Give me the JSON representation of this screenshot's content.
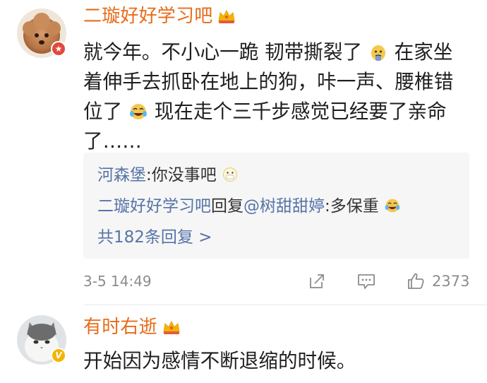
{
  "comments": [
    {
      "username": "二璇好好学习吧",
      "badge_icon": "crown-vip-icon",
      "avatar_icon": "poodle-dog-avatar",
      "avatar_badge_icon": "red-star-badge-icon",
      "content": {
        "line1_a": "就今年。不小心一跪 韧带撕裂了",
        "line1_emoji": "facepalm-emoji-icon",
        "line1_b": "在家坐",
        "line2": "着伸手去抓卧在地上的狗，咔一声、腰椎错",
        "line3_a": "位了",
        "line3_emoji": "laughing-crying-emoji-icon",
        "line3_b": "现在走个三千步感觉已经要了亲命",
        "line4": "了……"
      },
      "replies": [
        {
          "name": "河森堡",
          "separator": ":",
          "text": "你没事吧",
          "emoji": "mask-face-emoji-icon"
        },
        {
          "name": "二璇好好学习吧",
          "middle": "回复",
          "mention": "@树甜甜婷",
          "separator": ":",
          "text": "多保重",
          "emoji": "laughing-crying-emoji-icon"
        }
      ],
      "more_replies": "共182条回复 >",
      "timestamp": "3-5 14:49",
      "share_icon": "share-icon",
      "comment_icon": "comment-icon",
      "like_icon": "thumbs-up-icon",
      "like_count": "2373"
    },
    {
      "username": "有时右逝",
      "badge_icon": "crown-vip-icon",
      "avatar_icon": "cat-avatar",
      "avatar_badge_icon": "yellow-v-badge-icon",
      "content": {
        "line1": "开始因为感情不断退缩的时候。"
      }
    }
  ],
  "colors": {
    "username": "#e86b1a",
    "reply_name": "#5674a8",
    "text": "#1f1f1f",
    "muted": "#8c8c8c",
    "reply_bg": "#f6f6f6",
    "badge_red": "#e2483d",
    "badge_yellow": "#f4b400"
  }
}
